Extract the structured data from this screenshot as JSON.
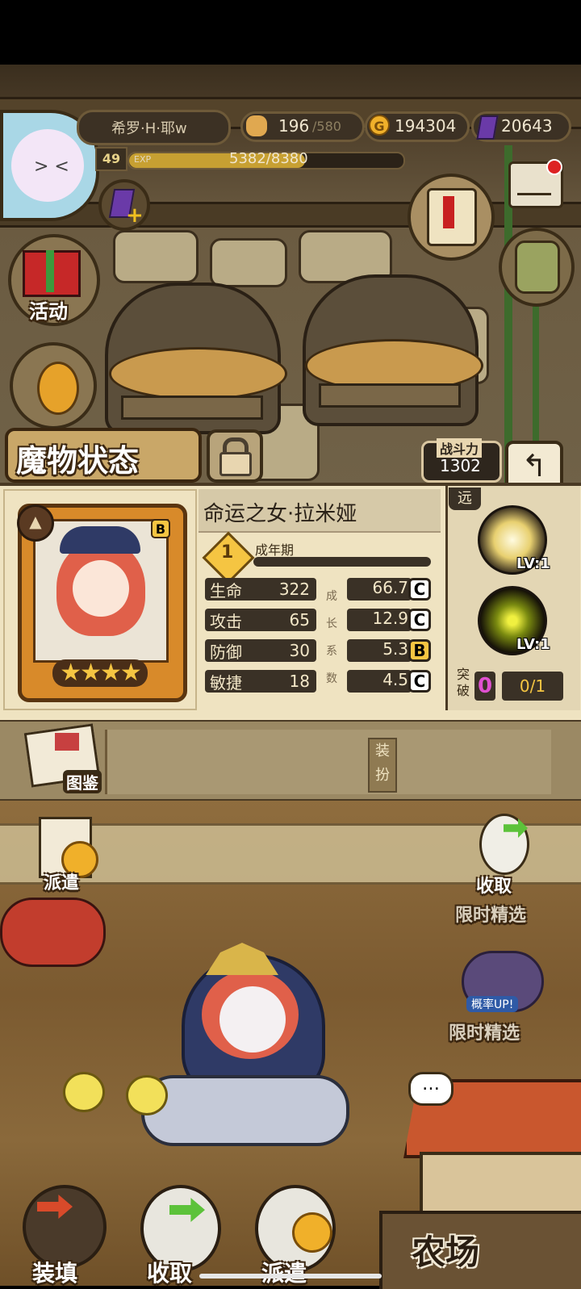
{
  "player": {
    "name": "希罗·H·耶w",
    "level": "49",
    "exp_label": "EXP",
    "exp_text": "5382/8380",
    "exp_fraction": 0.642
  },
  "resources": {
    "stamina": "196",
    "stamina_max": "/580",
    "gold": "194304",
    "gems": "20643"
  },
  "side_buttons": {
    "activity": "活动",
    "atlas": "图鉴",
    "dispatch": "派遣",
    "collect": "收取",
    "limited1": "限时精选",
    "limited2": "限时精选",
    "rate_up": "概率UP!"
  },
  "status": {
    "title": "魔物状态",
    "power_label": "战斗力",
    "power_value": "1302",
    "monster_name": "命运之女·拉米娅",
    "rank_badge": "B",
    "stage_num": "1",
    "stage_label": "成年期",
    "range_label": "远",
    "stars": 4,
    "growth_label": [
      "成",
      "长",
      "系",
      "数"
    ],
    "stats": [
      {
        "name": "生命",
        "value": "322",
        "growth": "66.7",
        "grade": "C"
      },
      {
        "name": "攻击",
        "value": "65",
        "growth": "12.9",
        "grade": "C"
      },
      {
        "name": "防御",
        "value": "30",
        "growth": "5.3",
        "grade": "B"
      },
      {
        "name": "敏捷",
        "value": "18",
        "growth": "4.5",
        "grade": "C"
      }
    ],
    "skills": [
      {
        "level": "LV:1"
      },
      {
        "level": "LV:1"
      }
    ],
    "breakthrough_label": "突破",
    "breakthrough_count": "0",
    "breakthrough_progress": "0/1",
    "equip_label": "装扮"
  },
  "bottom_bar": {
    "load": "装填",
    "collect": "收取",
    "dispatch": "派遣",
    "farm": "农场"
  },
  "colors": {
    "panel_bg": "#efe3c1",
    "dark_bar": "#3a3126",
    "grade_c": "#ffffff",
    "grade_b": "#f5c542",
    "breakthrough_pink": "#e050d0",
    "gold": "#f0b02a",
    "gem": "#6a3aa8"
  }
}
